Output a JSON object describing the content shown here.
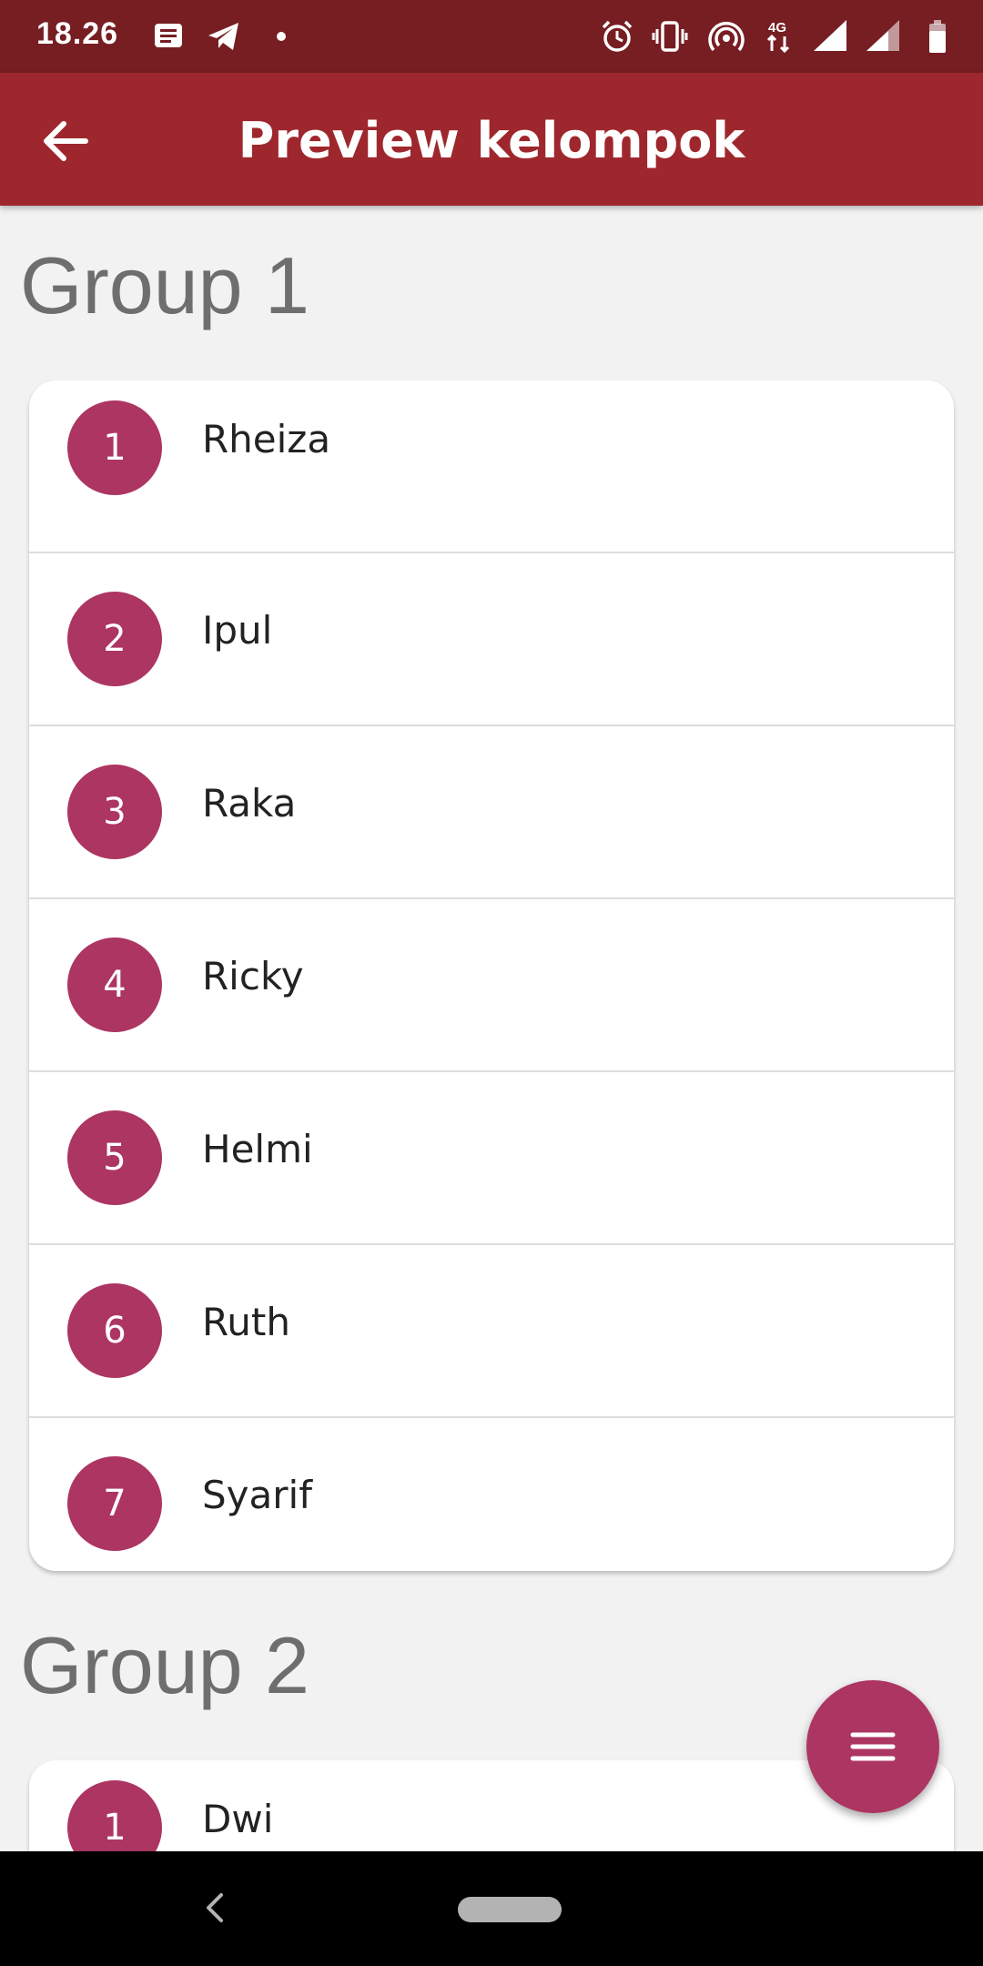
{
  "status_bar": {
    "time": "18.26",
    "icons": [
      "message-icon",
      "telegram-icon",
      "dot-icon",
      "alarm-icon",
      "vibrate-icon",
      "hotspot-icon",
      "4g-icon",
      "signal-icon",
      "signal-icon-2",
      "battery-icon"
    ]
  },
  "app_bar": {
    "title": "Preview kelompok",
    "back_icon": "arrow-left-icon"
  },
  "groups": [
    {
      "title": "Group 1",
      "members": [
        {
          "number": "1",
          "name": "Rheiza"
        },
        {
          "number": "2",
          "name": "Ipul"
        },
        {
          "number": "3",
          "name": "Raka"
        },
        {
          "number": "4",
          "name": "Ricky"
        },
        {
          "number": "5",
          "name": "Helmi"
        },
        {
          "number": "6",
          "name": "Ruth"
        },
        {
          "number": "7",
          "name": "Syarif"
        }
      ]
    },
    {
      "title": "Group 2",
      "members": [
        {
          "number": "1",
          "name": "Dwi"
        }
      ]
    }
  ],
  "fab": {
    "icon": "menu-icon"
  },
  "colors": {
    "status_bar": "#761e22",
    "app_bar": "#9e272d",
    "accent": "#ad3561",
    "background": "#f2f2f2"
  }
}
